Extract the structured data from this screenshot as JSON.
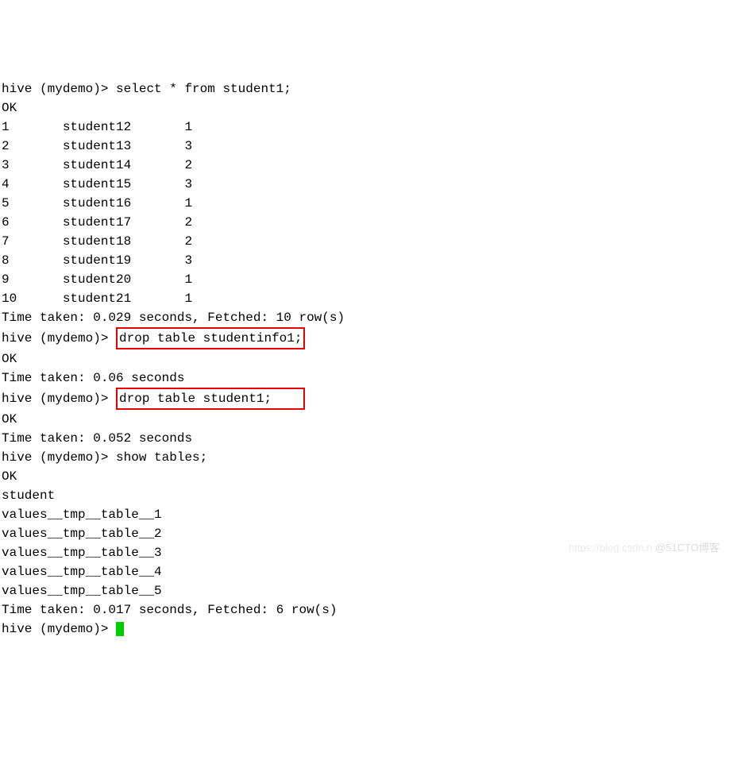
{
  "prompt": "hive (mydemo)> ",
  "cmd_select": "select * from student1;",
  "ok": "OK",
  "rows": [
    [
      "1",
      "student12",
      "1"
    ],
    [
      "2",
      "student13",
      "3"
    ],
    [
      "3",
      "student14",
      "2"
    ],
    [
      "4",
      "student15",
      "3"
    ],
    [
      "5",
      "student16",
      "1"
    ],
    [
      "6",
      "student17",
      "2"
    ],
    [
      "7",
      "student18",
      "2"
    ],
    [
      "8",
      "student19",
      "3"
    ],
    [
      "9",
      "student20",
      "1"
    ],
    [
      "10",
      "student21",
      "1"
    ]
  ],
  "time_select": "Time taken: 0.029 seconds, Fetched: 10 row(s)",
  "cmd_drop1": "drop table studentinfo1;",
  "time_drop1": "Time taken: 0.06 seconds",
  "cmd_drop2": "drop table student1;",
  "time_drop2": "Time taken: 0.052 seconds",
  "cmd_show": "show tables;",
  "tables": [
    "student",
    "values__tmp__table__1",
    "values__tmp__table__2",
    "values__tmp__table__3",
    "values__tmp__table__4",
    "values__tmp__table__5"
  ],
  "time_show": "Time taken: 0.017 seconds, Fetched: 6 row(s)",
  "watermark": "@51CTO博客",
  "watermark_faint": "https://blog.csdn.n"
}
